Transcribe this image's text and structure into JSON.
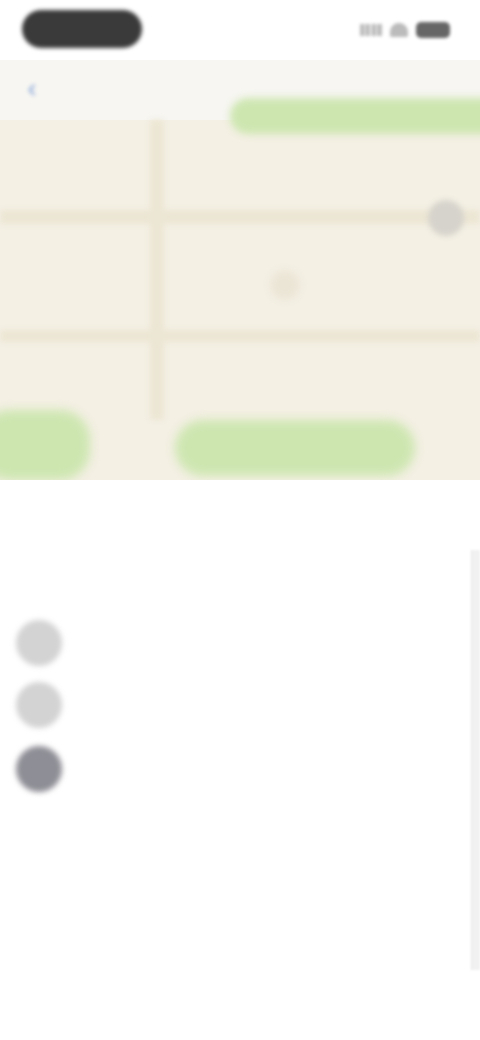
{
  "status_bar": {
    "icons": [
      "signal-icon",
      "wifi-icon",
      "battery-icon"
    ]
  },
  "map": {
    "back_icon": "chevron-left-icon",
    "label": "",
    "compass_icon": "compass-icon",
    "colors": {
      "land": "#f4f0e4",
      "park": "#cde6b0",
      "road": "#ece6d4"
    }
  },
  "place": {
    "title": "",
    "description": ""
  },
  "list": [
    {
      "name": "",
      "subtitle": ""
    },
    {
      "name": "",
      "subtitle": ""
    },
    {
      "name": "",
      "subtitle": ""
    }
  ]
}
